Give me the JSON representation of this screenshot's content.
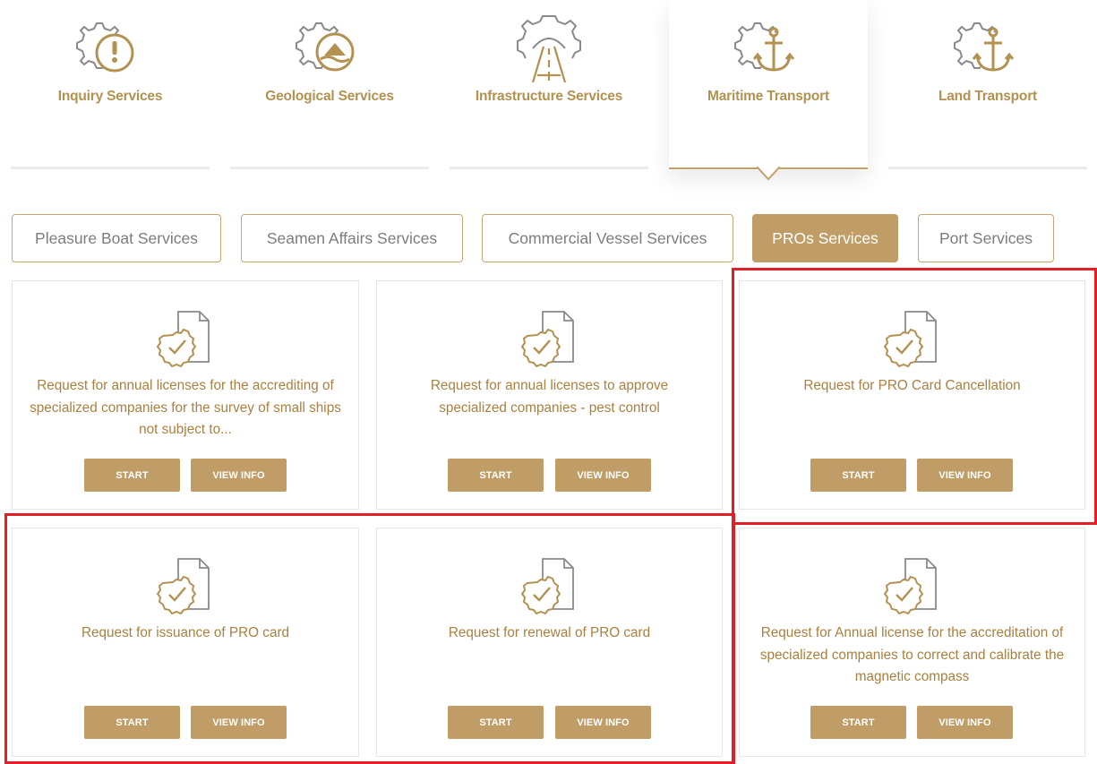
{
  "categories": [
    {
      "label": "Inquiry Services",
      "icon": "gear-exclamation-icon"
    },
    {
      "label": "Geological Services",
      "icon": "gear-geology-icon"
    },
    {
      "label": "Infrastructure Services",
      "icon": "gear-road-icon"
    },
    {
      "label": "Maritime Transport",
      "icon": "gear-anchor-icon",
      "active": true
    },
    {
      "label": "Land Transport",
      "icon": "gear-anchor-icon"
    }
  ],
  "subtabs": [
    {
      "label": "Pleasure Boat Services"
    },
    {
      "label": "Seamen Affairs Services"
    },
    {
      "label": "Commercial Vessel Services"
    },
    {
      "label": "PROs Services",
      "active": true
    },
    {
      "label": "Port Services"
    }
  ],
  "cards": [
    {
      "title": "Request for annual licenses for the accrediting of specialized companies for the survey of small ships not subject to...",
      "start": "START",
      "info": "VIEW INFO"
    },
    {
      "title": "Request for annual licenses to approve specialized companies - pest control",
      "start": "START",
      "info": "VIEW INFO"
    },
    {
      "title": "Request for PRO Card Cancellation",
      "start": "START",
      "info": "VIEW INFO"
    },
    {
      "title": "Request for issuance of PRO card",
      "start": "START",
      "info": "VIEW INFO"
    },
    {
      "title": "Request for renewal of PRO card",
      "start": "START",
      "info": "VIEW INFO"
    },
    {
      "title": "Request for Annual license for the accreditation of specialized companies to correct and calibrate the magnetic compass",
      "start": "START",
      "info": "VIEW INFO"
    }
  ],
  "colors": {
    "gold": "#c09d66",
    "gold_text": "#a9803f",
    "highlight": "#e21f26"
  }
}
